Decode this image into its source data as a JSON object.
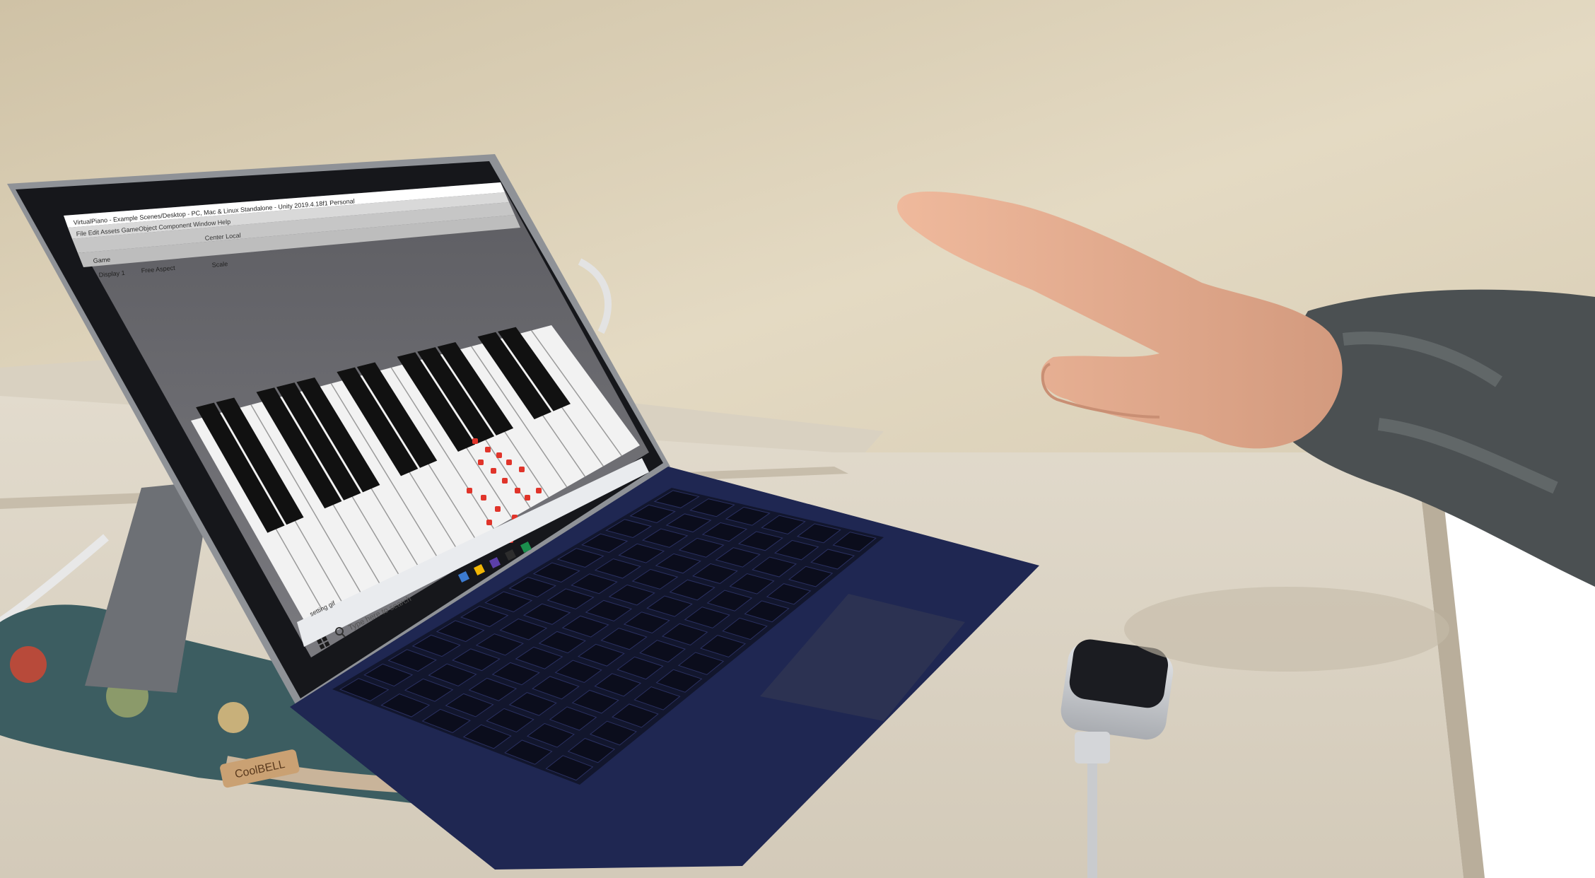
{
  "scene": {
    "colors": {
      "wall": "#d8cdb4",
      "wall_light": "#e6dcc6",
      "table": "#ddd5c6",
      "table_edge": "#bdb4a3",
      "laptop_frame": "#8e9196",
      "bezel": "#15161a",
      "cover_blue": "#1d2450",
      "keys": "#11142a",
      "trackpad": "#2a2f4c",
      "skin": "#e2a88b",
      "sleeve": "#4a4e50",
      "sensor_body": "#c9cbce",
      "sensor_top": "#1a1b1f",
      "piano_bg": "#6b6b70",
      "white_keys": "#f2f2f2",
      "black_keys": "#111111",
      "hand_markers": "#e0342a",
      "bag_teal": "#3a5f63",
      "bag_trim": "#c9b49a"
    },
    "screen": {
      "window_title": "VirtualPiano - Example Scenes/Desktop - PC, Mac & Linux Standalone - Unity 2019.4.18f1 Personal",
      "menu_bar": "File  Edit  Assets  GameObject  Component  Window  Help",
      "toolbar": "Center  Local",
      "game_tab": "Game",
      "display_label": "Display 1",
      "aspect_label": "Free Aspect",
      "scale_label": "Scale",
      "status_text": "setting gif",
      "taskbar_search_placeholder": "Type here to search"
    },
    "bag_label": "CoolBELL",
    "icons": [
      "windows-start-icon",
      "search-icon"
    ]
  }
}
